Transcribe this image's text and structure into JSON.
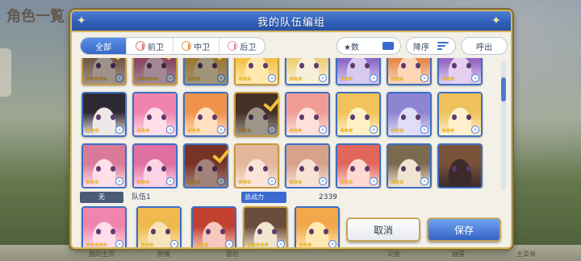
{
  "background": {
    "title": "角色一覧",
    "bottom_labels": [
      "我的主页",
      "剧情",
      "冒险",
      "公会",
      "抽蛋",
      "主菜单"
    ]
  },
  "modal": {
    "title": "我的队伍编组"
  },
  "filters": {
    "tabs": [
      {
        "label": "全部",
        "active": true
      },
      {
        "label": "前卫",
        "active": false
      },
      {
        "label": "中卫",
        "active": false
      },
      {
        "label": "后卫",
        "active": false
      }
    ],
    "sort_key_label": "★数",
    "sort_order_label": "降序",
    "call_out_label": "呼出"
  },
  "roster": {
    "rows": [
      [
        {
          "palette": [
            "#f3e1d6",
            "#b28b72"
          ],
          "stars": "★★★★★",
          "selected": true,
          "frame": "gold"
        },
        {
          "palette": [
            "#f7d2e3",
            "#d56e98"
          ],
          "stars": "★★★★★",
          "selected": true,
          "frame": "gold"
        },
        {
          "palette": [
            "#f7e4b8",
            "#f0b94d"
          ],
          "stars": "★★★",
          "selected": true,
          "frame": "blue"
        },
        {
          "palette": [
            "#ffe9b0",
            "#f3c14b"
          ],
          "stars": "★★★",
          "selected": false,
          "frame": "gold"
        },
        {
          "palette": [
            "#f6f0d8",
            "#efd07a"
          ],
          "stars": "★★★",
          "selected": false,
          "frame": "blue"
        },
        {
          "palette": [
            "#d8c9ef",
            "#8e6ac7"
          ],
          "stars": "★★★",
          "selected": false,
          "frame": "blue"
        },
        {
          "palette": [
            "#ffd5b8",
            "#e58a52"
          ],
          "stars": "★★★",
          "selected": false,
          "frame": "blue"
        },
        {
          "palette": [
            "#e6d0f1",
            "#9567c3"
          ],
          "stars": "★★★",
          "selected": false,
          "frame": "blue"
        }
      ],
      [
        {
          "palette": [
            "#efe8e8",
            "#2d2a33"
          ],
          "stars": "★★★",
          "selected": false,
          "frame": "blue"
        },
        {
          "palette": [
            "#ffdde9",
            "#ef85ad"
          ],
          "stars": "★★★",
          "selected": false,
          "frame": "blue"
        },
        {
          "palette": [
            "#ffe0c1",
            "#f0934a"
          ],
          "stars": "★★★",
          "selected": false,
          "frame": "blue"
        },
        {
          "palette": [
            "#f1e6d1",
            "#6a4d3d"
          ],
          "stars": "★★★",
          "selected": true,
          "frame": "gold"
        },
        {
          "palette": [
            "#ffe1dc",
            "#f19d96"
          ],
          "stars": "★★★",
          "selected": false,
          "frame": "blue"
        },
        {
          "palette": [
            "#fff0c6",
            "#f1c35a"
          ],
          "stars": "★★★",
          "selected": false,
          "frame": "blue"
        },
        {
          "palette": [
            "#e0def6",
            "#8d84d2"
          ],
          "stars": "★★★",
          "selected": false,
          "frame": "blue"
        },
        {
          "palette": [
            "#fff1cc",
            "#efc15a"
          ],
          "stars": "★★★",
          "selected": false,
          "frame": "blue"
        }
      ],
      [
        {
          "palette": [
            "#ffe0ea",
            "#d97a98"
          ],
          "stars": "★★★",
          "selected": false,
          "frame": "blue"
        },
        {
          "palette": [
            "#ffd3e6",
            "#e070a2"
          ],
          "stars": "★★★",
          "selected": false,
          "frame": "blue"
        },
        {
          "palette": [
            "#f7c9be",
            "#b94f3b"
          ],
          "stars": "★★★",
          "selected": true,
          "frame": "blue"
        },
        {
          "palette": [
            "#fbe5d8",
            "#e3b79a"
          ],
          "stars": "★★★",
          "selected": false,
          "frame": "gold"
        },
        {
          "palette": [
            "#f8e2d4",
            "#d8a28a"
          ],
          "stars": "★★★",
          "selected": false,
          "frame": "blue"
        },
        {
          "palette": [
            "#ffd8cf",
            "#e2665c"
          ],
          "stars": "★★★",
          "selected": false,
          "frame": "blue"
        },
        {
          "palette": [
            "#eee6d3",
            "#7c6a4f"
          ],
          "stars": "★★★",
          "selected": false,
          "frame": "blue"
        },
        {
          "palette": [
            "#3a2a2a",
            "#7a5238"
          ],
          "stars": "",
          "selected": false,
          "frame": "blue"
        }
      ]
    ]
  },
  "team": {
    "prefix_label": "无",
    "name": "队伍1",
    "power_label": "总战力",
    "power_value": "2339",
    "members": [
      {
        "palette": [
          "#ffdde9",
          "#ef85ad"
        ],
        "stars": "★★★★★"
      },
      {
        "palette": [
          "#f7e4b8",
          "#f0b94d"
        ],
        "stars": "★★★"
      },
      {
        "palette": [
          "#f7c9be",
          "#c2402f"
        ],
        "stars": "★★★"
      },
      {
        "palette": [
          "#f1e6d1",
          "#6a4d3d"
        ],
        "stars": "★★★★★"
      },
      {
        "palette": [
          "#ffe9b0",
          "#f3a74b"
        ],
        "stars": "★★★"
      }
    ]
  },
  "actions": {
    "cancel_label": "取消",
    "save_label": "保存"
  },
  "colors": {
    "header_blue": "#2e5db6",
    "frame_gold": "#d8b45a",
    "accent_blue": "#3a6ad0",
    "check_yellow": "#f0c23a"
  }
}
